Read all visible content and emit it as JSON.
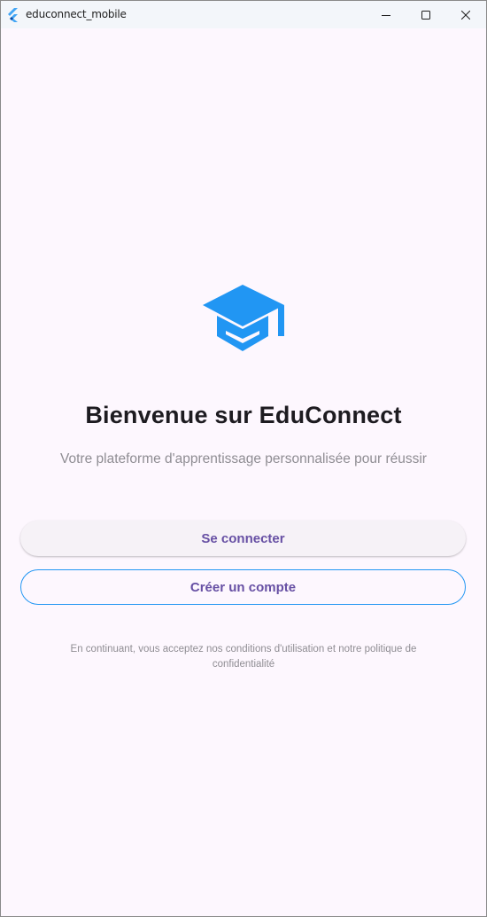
{
  "window": {
    "title": "educonnect_mobile",
    "icon": "flutter-logo-icon",
    "controls": [
      "minimize-icon",
      "maximize-icon",
      "close-icon"
    ]
  },
  "colors": {
    "background": "#fdf7fe",
    "logo": "#2196f3",
    "button_text": "#6750a4",
    "outline": "#2196f3",
    "muted_text": "#8f8d93"
  },
  "main": {
    "logo_icon": "graduation-cap-icon",
    "heading": "Bienvenue sur EduConnect",
    "subtitle": "Votre plateforme d'apprentissage personnalisée pour réussir",
    "login_label": "Se connecter",
    "register_label": "Créer un compte",
    "legal_text": "En continuant, vous acceptez nos conditions d'utilisation et notre politique de confidentialité"
  }
}
